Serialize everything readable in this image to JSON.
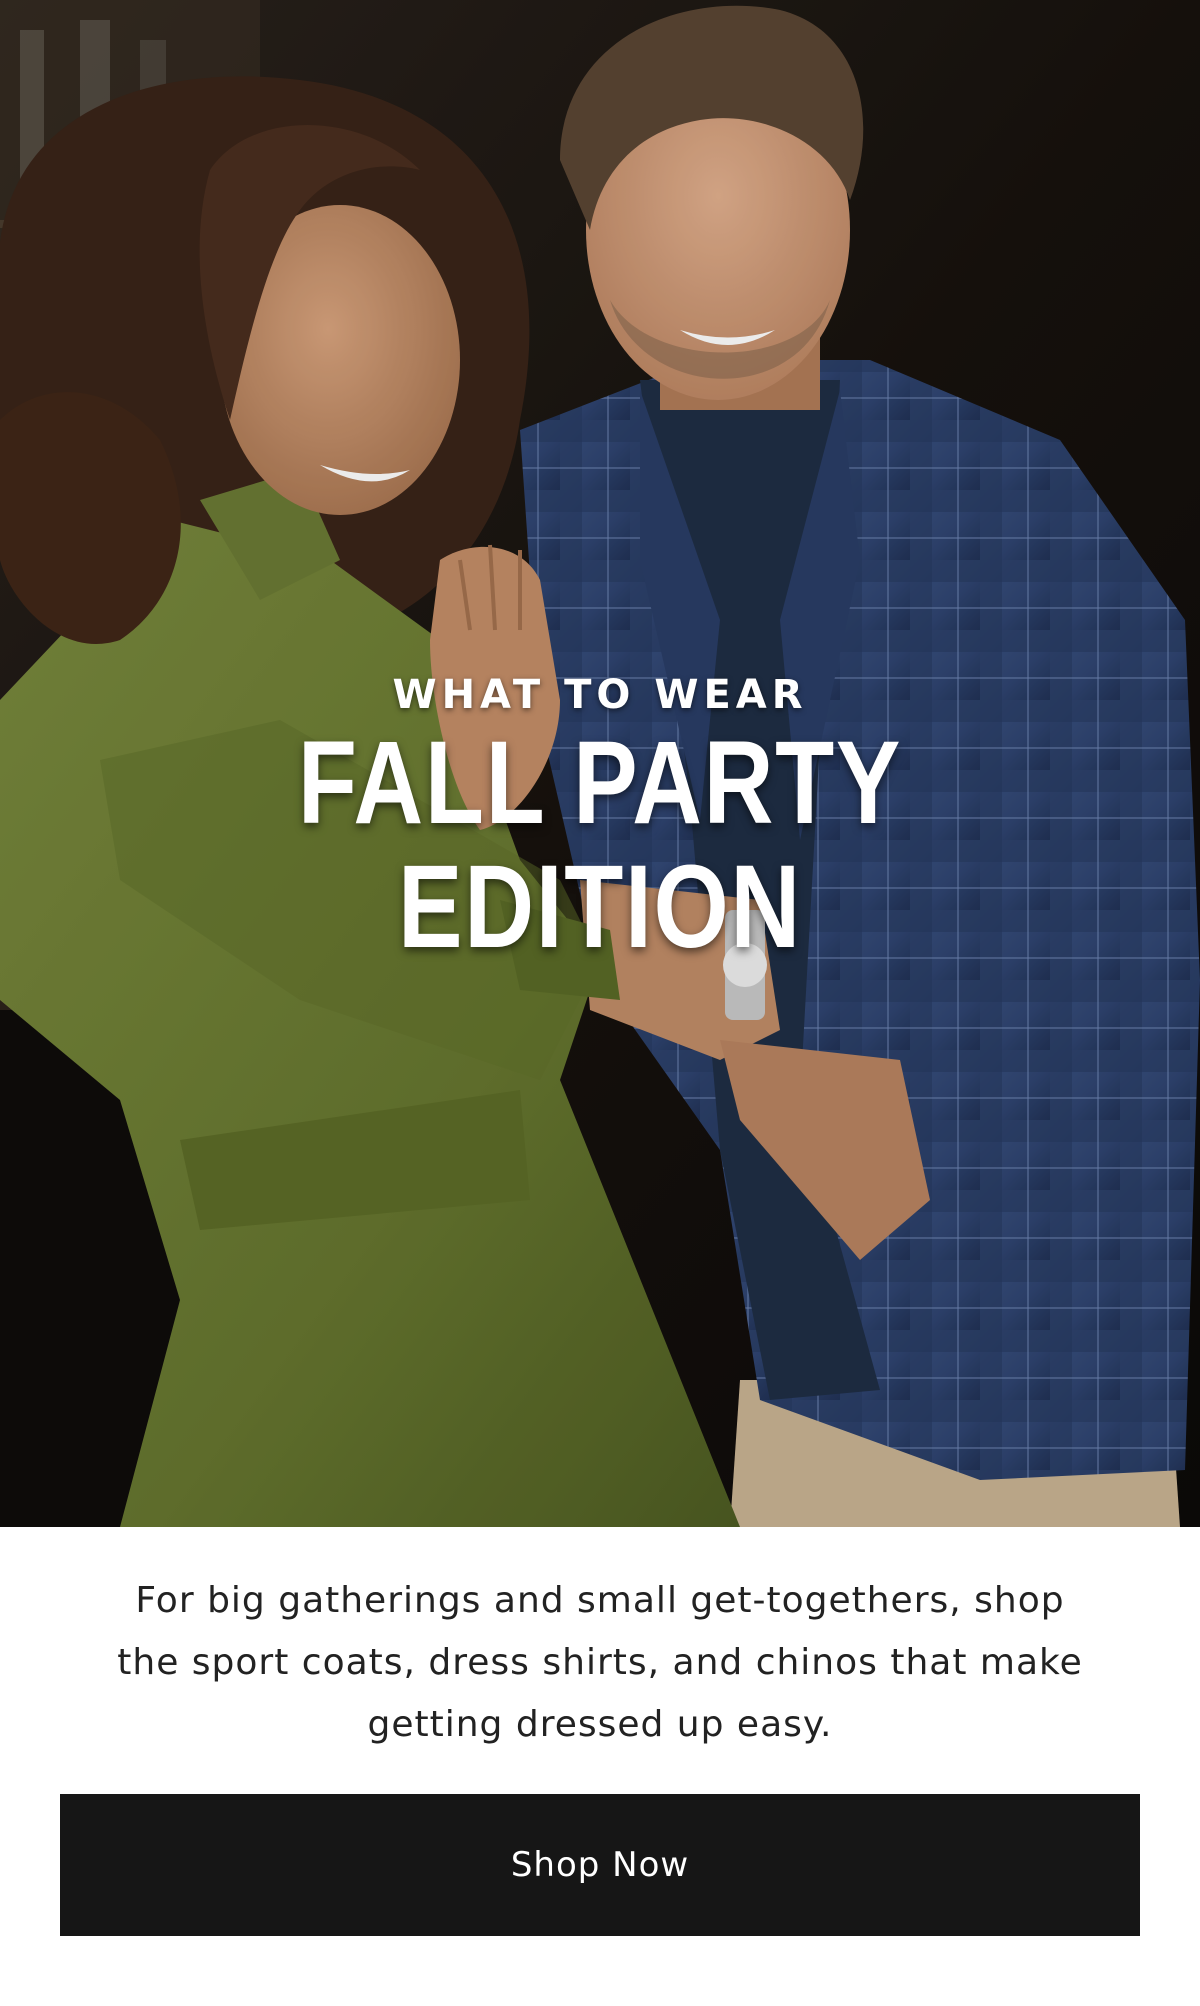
{
  "hero": {
    "eyebrow": "WHAT TO WEAR",
    "headline": "FALL PARTY EDITION",
    "image_description_icon": "couple-photo",
    "colors": {
      "dress": "#6b7a35",
      "blazer": "#2f4470",
      "shirt": "#1f2e45",
      "chinos": "#c9b393",
      "background": "#1a1410"
    }
  },
  "body": {
    "description": "For big gatherings and small get-togethers, shop the sport coats, dress shirts, and chinos that make getting dressed up easy."
  },
  "cta": {
    "label": "Shop Now",
    "background": "#161616",
    "text_color": "#ffffff"
  }
}
